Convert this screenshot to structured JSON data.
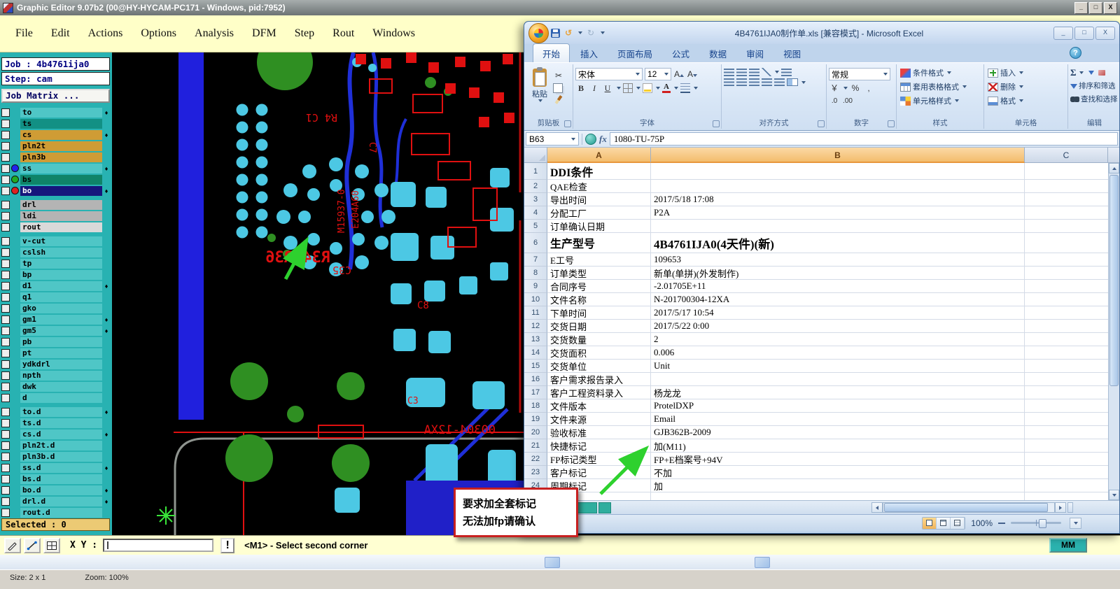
{
  "graphic_editor": {
    "window_title": "Graphic Editor 9.07b2 (00@HY-HYCAM-PC171 - Windows, pid:7952)",
    "window_buttons": [
      "_",
      "□",
      "X"
    ],
    "menus": [
      "File",
      "Edit",
      "Actions",
      "Options",
      "Analysis",
      "DFM",
      "Step",
      "Rout",
      "Windows"
    ],
    "job_label": "Job : 4b4761ija0",
    "step_label": "Step: cam",
    "job_matrix_label": "Job Matrix ...",
    "layers": [
      {
        "name": "to",
        "style": "cyan",
        "marker": "♦"
      },
      {
        "name": "ts",
        "style": "darkteal",
        "marker": ""
      },
      {
        "name": "cs",
        "style": "orange",
        "marker": "♦"
      },
      {
        "name": "pln2t",
        "style": "orange",
        "marker": ""
      },
      {
        "name": "pln3b",
        "style": "orange",
        "marker": ""
      },
      {
        "name": "ss",
        "style": "cyan",
        "dot": "#2222ee",
        "marker": "♦"
      },
      {
        "name": "bs",
        "style": "green",
        "dot": "#22aa22",
        "marker": ""
      },
      {
        "name": "bo",
        "style": "navy",
        "dot": "#dd2222",
        "marker": "♦",
        "gap_after": true
      },
      {
        "name": "drl",
        "style": "gray",
        "marker": ""
      },
      {
        "name": "ldi",
        "style": "gray",
        "marker": ""
      },
      {
        "name": "rout",
        "style": "lightg",
        "marker": "",
        "gap_after": true
      },
      {
        "name": "v-cut",
        "style": "cyan",
        "marker": ""
      },
      {
        "name": "cslsh",
        "style": "cyan",
        "marker": ""
      },
      {
        "name": "tp",
        "style": "cyan",
        "marker": ""
      },
      {
        "name": "bp",
        "style": "cyan",
        "marker": ""
      },
      {
        "name": "d1",
        "style": "cyan",
        "marker": "♦"
      },
      {
        "name": "q1",
        "style": "cyan",
        "marker": ""
      },
      {
        "name": "gko",
        "style": "cyan",
        "marker": ""
      },
      {
        "name": "gm1",
        "style": "cyan",
        "marker": "♦"
      },
      {
        "name": "gm5",
        "style": "cyan",
        "marker": "♦"
      },
      {
        "name": "pb",
        "style": "cyan",
        "marker": ""
      },
      {
        "name": "pt",
        "style": "cyan",
        "marker": ""
      },
      {
        "name": "ydkdrl",
        "style": "cyan",
        "marker": ""
      },
      {
        "name": "npth",
        "style": "cyan",
        "marker": ""
      },
      {
        "name": "dwk",
        "style": "cyan",
        "marker": ""
      },
      {
        "name": "d",
        "style": "cyan",
        "marker": "",
        "gap_after": true
      },
      {
        "name": "to.d",
        "style": "cyan",
        "marker": "♦"
      },
      {
        "name": "ts.d",
        "style": "cyan",
        "marker": ""
      },
      {
        "name": "cs.d",
        "style": "cyan",
        "marker": "♦"
      },
      {
        "name": "pln2t.d",
        "style": "cyan",
        "marker": ""
      },
      {
        "name": "pln3b.d",
        "style": "cyan",
        "marker": ""
      },
      {
        "name": "ss.d",
        "style": "cyan",
        "marker": "♦"
      },
      {
        "name": "bs.d",
        "style": "cyan",
        "marker": ""
      },
      {
        "name": "bo.d",
        "style": "cyan",
        "marker": "♦"
      },
      {
        "name": "drl.d",
        "style": "cyan",
        "marker": "♦"
      },
      {
        "name": "rout.d",
        "style": "cyan",
        "marker": ""
      }
    ],
    "selected_label": "Selected : 0",
    "xy_label": "X Y :",
    "xy_value": "",
    "alert_label": "!",
    "status_message": "<M1> - Select second corner",
    "units_label": "MM",
    "size_status": "Size: 2 x 1",
    "zoom_status": "Zoom: 100%"
  },
  "pcb": {
    "labels": {
      "r4c1": "R4 C1",
      "c7": "C7",
      "e204": "E204A60",
      "m159": "M15937-0",
      "c35": "C35",
      "r34r36": "R34 R36",
      "c8": "C8",
      "c3": "C3",
      "bottom_text": "00304-12XA"
    }
  },
  "excel": {
    "window_title": "4B4761IJA0制作单.xls [兼容模式] - Microsoft Excel",
    "window_buttons": [
      "_",
      "□",
      "X"
    ],
    "help_label": "?",
    "tabs": [
      "开始",
      "插入",
      "页面布局",
      "公式",
      "数据",
      "审阅",
      "视图"
    ],
    "active_tab_index": 0,
    "ribbon": {
      "group_labels": [
        "剪贴板",
        "字体",
        "对齐方式",
        "数字",
        "样式",
        "单元格",
        "编辑"
      ],
      "paste_label": "粘贴",
      "font_name": "宋体",
      "font_size": "12",
      "grow_font": "A",
      "shrink_font": "A",
      "bold": "B",
      "italic": "I",
      "underline": "U",
      "font_color_letter": "A",
      "number_format": "常规",
      "currency": "￥",
      "percent": "%",
      "comma": ",",
      "inc_dec": ".0",
      "dec_dec": ".00",
      "sum": "Σ",
      "styles_buttons": [
        "条件格式",
        "套用表格格式",
        "单元格样式"
      ],
      "cells_buttons": [
        "插入",
        "删除",
        "格式"
      ],
      "editing_buttons": [
        "排序和筛选",
        "查找和选择"
      ],
      "fx_label": "fx"
    },
    "name_box": "B63",
    "formula": "1080-TU-75P",
    "columns": [
      "A",
      "B",
      "C"
    ],
    "rows": [
      {
        "n": 1,
        "a": "DDI条件",
        "b": ""
      },
      {
        "n": 2,
        "a": "QAE检查",
        "b": ""
      },
      {
        "n": 3,
        "a": "导出时间",
        "b": "2017/5/18 17:08"
      },
      {
        "n": 4,
        "a": "分配工厂",
        "b": "P2A"
      },
      {
        "n": 5,
        "a": "订单确认日期",
        "b": ""
      },
      {
        "n": 6,
        "a": "生产型号",
        "b": "4B4761IJA0(4天件)(新)"
      },
      {
        "n": 7,
        "a": "E工号",
        "b": "109653"
      },
      {
        "n": 8,
        "a": "订单类型",
        "b": "新单(单拼)(外发制作)"
      },
      {
        "n": 9,
        "a": "合同序号",
        "b": "-2.01705E+11"
      },
      {
        "n": 10,
        "a": "文件名称",
        "b": "N-201700304-12XA"
      },
      {
        "n": 11,
        "a": "下单时间",
        "b": "2017/5/17 10:54"
      },
      {
        "n": 12,
        "a": "交货日期",
        "b": "2017/5/22 0:00"
      },
      {
        "n": 13,
        "a": "交货数量",
        "b": "2"
      },
      {
        "n": 14,
        "a": "交货面积",
        "b": "0.006"
      },
      {
        "n": 15,
        "a": "交货单位",
        "b": "Unit"
      },
      {
        "n": 16,
        "a": "客户需求报告录入",
        "b": ""
      },
      {
        "n": 17,
        "a": "客户工程资料录入",
        "b": "杨龙龙"
      },
      {
        "n": 18,
        "a": "文件版本",
        "b": "ProtelDXP"
      },
      {
        "n": 19,
        "a": "文件来源",
        "b": "Email"
      },
      {
        "n": 20,
        "a": "验收标准",
        "b": "GJB362B-2009"
      },
      {
        "n": 21,
        "a": "快捷标记",
        "b": "加(M11)"
      },
      {
        "n": 22,
        "a": "FP标记类型",
        "b": "FP+E档案号+94V"
      },
      {
        "n": 23,
        "a": "客户标记",
        "b": "不加"
      },
      {
        "n": 24,
        "a": "周期标记",
        "b": "加"
      },
      {
        "n": 25,
        "a": "",
        "b": ""
      }
    ],
    "zoom": "100%"
  },
  "icons": {
    "scissors": "✂",
    "undo": "↺",
    "redo": "↻"
  },
  "callout": {
    "line1": "要求加全套标记",
    "line2": "无法加fp请确认"
  }
}
